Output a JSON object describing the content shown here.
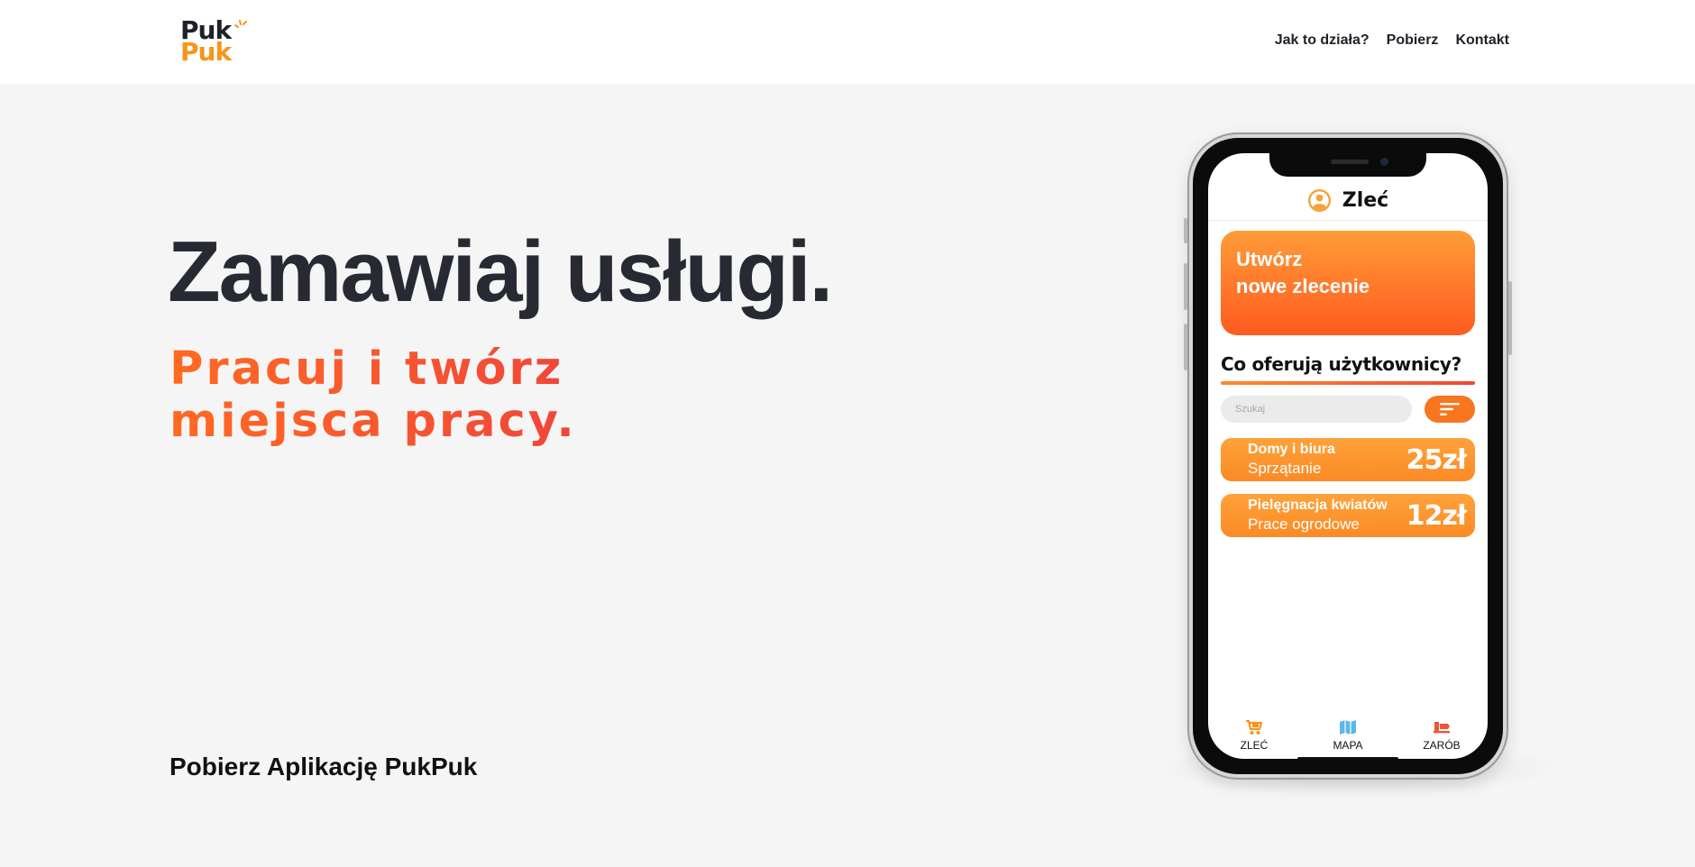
{
  "header": {
    "logo": {
      "line1": "Puk",
      "line2": "Puk",
      "icon": "sparkle-icon"
    },
    "nav": [
      {
        "label": "Jak to działa?"
      },
      {
        "label": "Pobierz"
      },
      {
        "label": "Kontakt"
      }
    ]
  },
  "hero": {
    "title": "Zamawiaj usługi.",
    "subtitle_line1": "Pracuj i twórz",
    "subtitle_line2": "miejsca pracy.",
    "download_heading": "Pobierz Aplikację PukPuk"
  },
  "phone_app": {
    "header_title": "Zleć",
    "header_icon": "user-icon",
    "create_card": {
      "line1": "Utwórz",
      "line2": "nowe zlecenie"
    },
    "section_title": "Co oferują użytkownicy?",
    "search_placeholder": "Szukaj",
    "filter_icon": "filter-icon",
    "offers": [
      {
        "title": "Domy i biura",
        "category": "Sprzątanie",
        "price": "25zł"
      },
      {
        "title": "Pielęgnacja kwiatów",
        "category": "Prace ogrodowe",
        "price": "12zł"
      }
    ],
    "tabs": [
      {
        "label": "ZLEĆ",
        "icon": "cart-icon",
        "color": "#f7941d"
      },
      {
        "label": "MAPA",
        "icon": "map-icon",
        "color": "#5bb8ea"
      },
      {
        "label": "ZARÓB",
        "icon": "earn-icon",
        "color": "#f0553a"
      }
    ]
  },
  "colors": {
    "brand_orange": "#f7941d",
    "accent_red": "#f0463a",
    "title_dark": "#272a33",
    "background": "#f5f5f5"
  }
}
